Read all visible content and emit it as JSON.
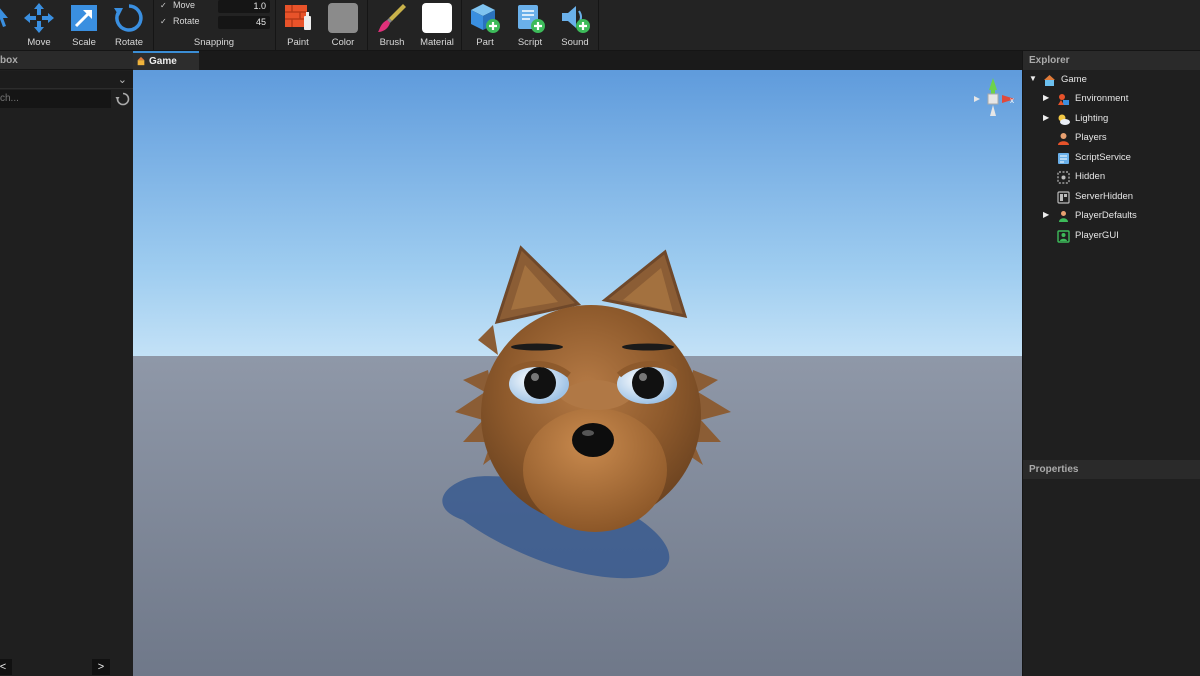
{
  "toolbar": {
    "select_label": "ct",
    "move_label": "Move",
    "scale_label": "Scale",
    "rotate_label": "Rotate",
    "snapping": {
      "title": "Snapping",
      "move_label": "Move",
      "move_value": "1.0",
      "rotate_label": "Rotate",
      "rotate_value": "45"
    },
    "paint_label": "Paint",
    "color_label": "Color",
    "brush_label": "Brush",
    "material_label": "Material",
    "part_label": "Part",
    "script_label": "Script",
    "sound_label": "Sound"
  },
  "toolbox": {
    "title": "box",
    "search_placeholder": "ch...",
    "prev_label": "<",
    "next_label": ">"
  },
  "viewport": {
    "tab_label": "Game"
  },
  "explorer": {
    "title": "Explorer",
    "items": [
      {
        "label": "Game",
        "expander": "▼",
        "icon": "game-icon"
      },
      {
        "label": "Environment",
        "expander": "▶",
        "icon": "environment-icon"
      },
      {
        "label": "Lighting",
        "expander": "▶",
        "icon": "lighting-icon"
      },
      {
        "label": "Players",
        "expander": "",
        "icon": "players-icon"
      },
      {
        "label": "ScriptService",
        "expander": "",
        "icon": "script-service-icon"
      },
      {
        "label": "Hidden",
        "expander": "",
        "icon": "hidden-icon"
      },
      {
        "label": "ServerHidden",
        "expander": "",
        "icon": "server-hidden-icon"
      },
      {
        "label": "PlayerDefaults",
        "expander": "▶",
        "icon": "player-defaults-icon"
      },
      {
        "label": "PlayerGUI",
        "expander": "",
        "icon": "player-gui-icon"
      }
    ]
  },
  "properties": {
    "title": "Properties"
  },
  "colors": {
    "accent": "#3b8ed6",
    "panel_bg": "#1f1f1f",
    "toolbar_bg": "#232323"
  }
}
